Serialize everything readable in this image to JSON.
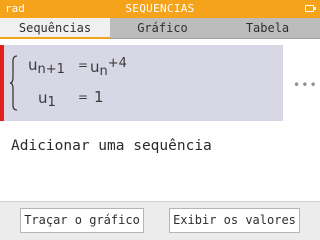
{
  "status_bar": {
    "mode": "rad",
    "title": "SEQUENCIAS"
  },
  "tabs": [
    {
      "label": "Sequências",
      "active": true
    },
    {
      "label": "Gráfico",
      "active": false
    },
    {
      "label": "Tabela",
      "active": false
    }
  ],
  "sequence": {
    "recurrence": {
      "lhs_base": "u",
      "lhs_sub": "n+1",
      "equals": "=",
      "rhs_base": "u",
      "rhs_sub": "n",
      "rhs_sup": "+4"
    },
    "initial": {
      "base": "u",
      "sub": "1",
      "equals": "=",
      "value": "1"
    },
    "menu_icon": "more-horizontal-icon"
  },
  "add_sequence_label": "Adicionar uma sequência",
  "bottom_buttons": {
    "plot": "Traçar o gráfico",
    "values": "Exibir os valores"
  },
  "colors": {
    "accent": "#f5a31b",
    "sequence_marker": "#e3201b",
    "sequence_bg": "#d7d7e6"
  }
}
